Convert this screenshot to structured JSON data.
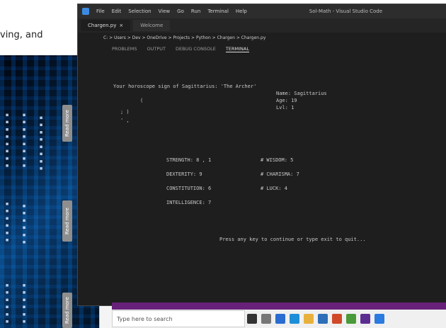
{
  "background_doc": {
    "text": "ving, and"
  },
  "left_pane": {
    "side_tabs": [
      "Read more",
      "Read more",
      "Read more"
    ]
  },
  "window": {
    "menu": [
      "File",
      "Edit",
      "Selection",
      "View",
      "Go",
      "Run",
      "Terminal",
      "Help"
    ],
    "title": "Sol-Math - Visual Studio Code",
    "tabs": [
      {
        "label": "Chargen.py",
        "active": true
      },
      {
        "label": "Welcome",
        "active": false
      }
    ],
    "breadcrumb": "C: > Users > Dev > OneDrive > Projects > Python > Chargen > Chargen.py",
    "panel_tabs": [
      "PROBLEMS",
      "OUTPUT",
      "DEBUG CONSOLE",
      "TERMINAL"
    ],
    "terminal": {
      "intro": "Your horoscope sign of Sagittarius: 'The Archer'",
      "stat1": "Name: Sagittarius",
      "stat2": "Age: 19",
      "stat3": "Lvl: 1",
      "art1": "  (",
      "art2": "  ;  )",
      "art3": "  ' ,",
      "row1_left": "STRENGTH: 8   ,   1",
      "row1_right": "# WISDOM: 5",
      "row2_left": "DEXTERITY: 9",
      "row2_right": "# CHARISMA: 7",
      "row3_left": "CONSTITUTION: 6",
      "row3_right": "# LUCK: 4",
      "row4_left": "INTELLIGENCE: 7",
      "prompt": "Press any key to continue or type exit to quit..."
    }
  },
  "taskbar": {
    "search_placeholder": "Type here to search"
  },
  "colors": {
    "status_bar": "#68217a",
    "terminal_bg": "#1e1e1e"
  }
}
